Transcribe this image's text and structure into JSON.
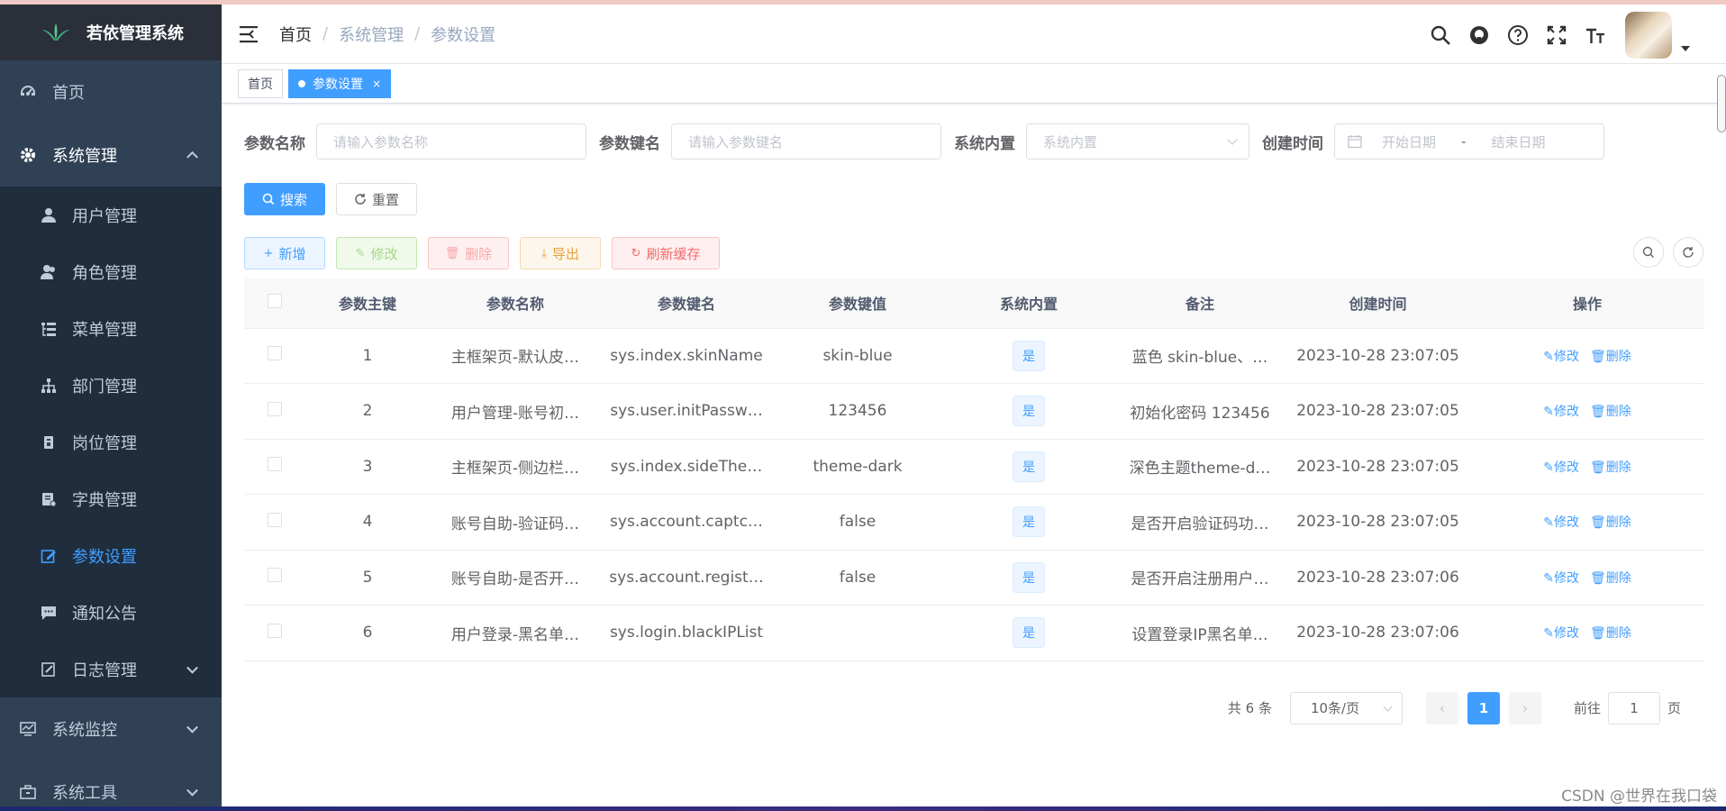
{
  "app": {
    "title": "若依管理系统"
  },
  "sidebar": {
    "home": "首页",
    "system": "系统管理",
    "sub": [
      "用户管理",
      "角色管理",
      "菜单管理",
      "部门管理",
      "岗位管理",
      "字典管理",
      "参数设置",
      "通知公告",
      "日志管理"
    ],
    "monitor": "系统监控",
    "tools": "系统工具",
    "active": "参数设置"
  },
  "breadcrumb": {
    "home": "首页",
    "sep": "/",
    "level1": "系统管理",
    "level2": "参数设置"
  },
  "tags": {
    "home": "首页",
    "current": "参数设置",
    "close": "×"
  },
  "search": {
    "name_label": "参数名称",
    "name_placeholder": "请输入参数名称",
    "key_label": "参数键名",
    "key_placeholder": "请输入参数键名",
    "type_label": "系统内置",
    "type_placeholder": "系统内置",
    "time_label": "创建时间",
    "start_placeholder": "开始日期",
    "range_sep": "-",
    "end_placeholder": "结束日期",
    "search_btn": "搜索",
    "reset_btn": "重置"
  },
  "toolbar": {
    "add": "新增",
    "edit": "修改",
    "delete": "删除",
    "export": "导出",
    "refresh_cache": "刷新缓存"
  },
  "table": {
    "headers": [
      "参数主键",
      "参数名称",
      "参数键名",
      "参数键值",
      "系统内置",
      "备注",
      "创建时间",
      "操作"
    ],
    "rows": [
      {
        "id": "1",
        "name": "主框架页-默认皮…",
        "key": "sys.index.skinName",
        "value": "skin-blue",
        "builtin": "是",
        "remark": "蓝色 skin-blue、…",
        "time": "2023-10-28 23:07:05"
      },
      {
        "id": "2",
        "name": "用户管理-账号初…",
        "key": "sys.user.initPassw…",
        "value": "123456",
        "builtin": "是",
        "remark": "初始化密码 123456",
        "time": "2023-10-28 23:07:05"
      },
      {
        "id": "3",
        "name": "主框架页-侧边栏…",
        "key": "sys.index.sideThe…",
        "value": "theme-dark",
        "builtin": "是",
        "remark": "深色主题theme-d…",
        "time": "2023-10-28 23:07:05"
      },
      {
        "id": "4",
        "name": "账号自助-验证码…",
        "key": "sys.account.captc…",
        "value": "false",
        "builtin": "是",
        "remark": "是否开启验证码功…",
        "time": "2023-10-28 23:07:05"
      },
      {
        "id": "5",
        "name": "账号自助-是否开…",
        "key": "sys.account.regist…",
        "value": "false",
        "builtin": "是",
        "remark": "是否开启注册用户…",
        "time": "2023-10-28 23:07:06"
      },
      {
        "id": "6",
        "name": "用户登录-黑名单…",
        "key": "sys.login.blackIPList",
        "value": "",
        "builtin": "是",
        "remark": "设置登录IP黑名单…",
        "time": "2023-10-28 23:07:06"
      }
    ],
    "edit_label": "修改",
    "delete_label": "删除"
  },
  "pagination": {
    "total": "共 6 条",
    "page_size": "10条/页",
    "current": "1",
    "goto_prefix": "前往",
    "goto_value": "1",
    "goto_suffix": "页"
  },
  "watermark": "CSDN @世界在我口袋",
  "colors": {
    "sidebar": "#304156",
    "accent": "#409eff"
  }
}
